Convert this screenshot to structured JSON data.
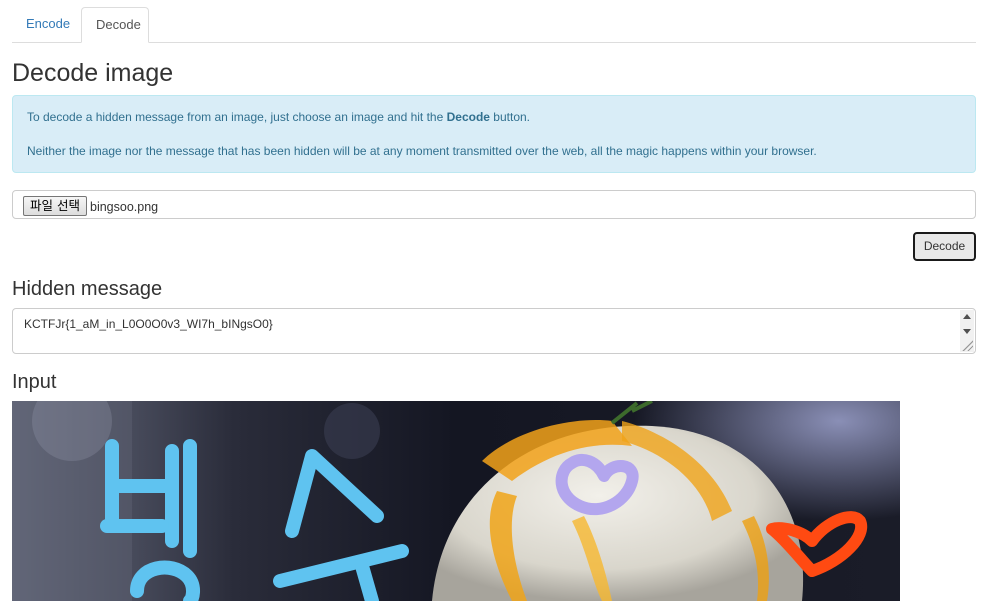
{
  "tabs": {
    "encode": "Encode",
    "decode": "Decode"
  },
  "page_title": "Decode image",
  "info": {
    "line1_prefix": "To decode a hidden message from an image, just choose an image and hit the ",
    "line1_bold": "Decode",
    "line1_suffix": " button.",
    "line2": "Neither the image nor the message that has been hidden will be at any moment transmitted over the web, all the magic happens within your browser."
  },
  "file_input": {
    "button_label": "파일 선택",
    "file_name": "bingsoo.png"
  },
  "decode_button": "Decode",
  "hidden_message": {
    "heading": "Hidden message",
    "value": "KCTFJr{1_aM_in_L0O0O0v3_WI7h_bINgsO0}"
  },
  "input_section": {
    "heading": "Input"
  },
  "colors": {
    "link": "#337ab7",
    "info_bg": "#d9edf7",
    "info_text": "#31708f",
    "doodle_blue": "#5fc3f0",
    "doodle_purple": "#b3a6ee",
    "doodle_orange": "#ff4a12"
  }
}
